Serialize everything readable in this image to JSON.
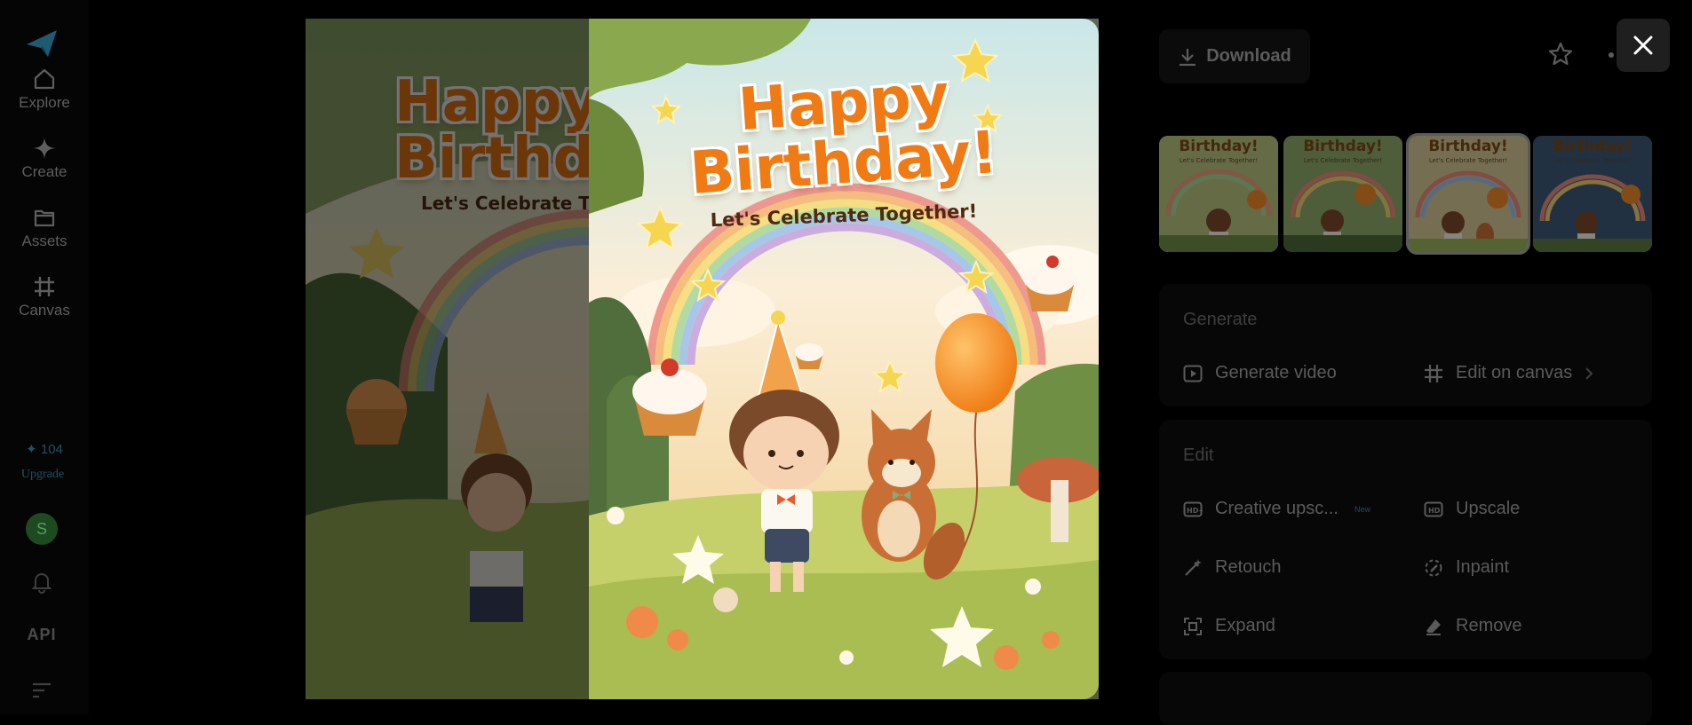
{
  "sidebar": {
    "items": [
      {
        "label": "Explore",
        "icon": "home-icon"
      },
      {
        "label": "Create",
        "icon": "sparkle-icon"
      },
      {
        "label": "Assets",
        "icon": "folder-icon"
      },
      {
        "label": "Canvas",
        "icon": "canvas-crop-icon"
      }
    ],
    "credits": "104",
    "upgrade_label": "Upgrade",
    "avatar_initial": "S",
    "api_label": "API"
  },
  "artwork": {
    "title_line1": "Happy",
    "title_line2": "Birthday!",
    "subtitle": "Let's Celebrate Together!"
  },
  "toolbar": {
    "download_label": "Download"
  },
  "thumbnails": [
    {
      "title": "Birthday!",
      "subtitle": "Let's Celebrate Together!",
      "selected": false
    },
    {
      "title": "Birthday!",
      "subtitle": "Let's Celebrate Together!",
      "selected": false
    },
    {
      "title": "Birthday!",
      "subtitle": "Let's Celebrate Together!",
      "selected": true
    },
    {
      "title": "Birthday!",
      "subtitle": "Let's Celebrate Together!",
      "selected": false
    }
  ],
  "generate": {
    "title": "Generate",
    "actions": [
      {
        "label": "Generate video",
        "icon": "play-icon"
      },
      {
        "label": "Edit on canvas",
        "icon": "canvas-crop-icon"
      }
    ]
  },
  "edit": {
    "title": "Edit",
    "actions": [
      {
        "label": "Creative upsc...",
        "icon": "hd-plus-icon",
        "badge": "New"
      },
      {
        "label": "Upscale",
        "icon": "hd-icon"
      },
      {
        "label": "Retouch",
        "icon": "magic-wand-icon"
      },
      {
        "label": "Inpaint",
        "icon": "inpaint-icon"
      },
      {
        "label": "Expand",
        "icon": "expand-icon"
      },
      {
        "label": "Remove",
        "icon": "eraser-icon"
      }
    ]
  },
  "colors": {
    "accent_title": "#f07a13",
    "credits": "#1f5360",
    "avatar_bg": "#1e4a22"
  }
}
